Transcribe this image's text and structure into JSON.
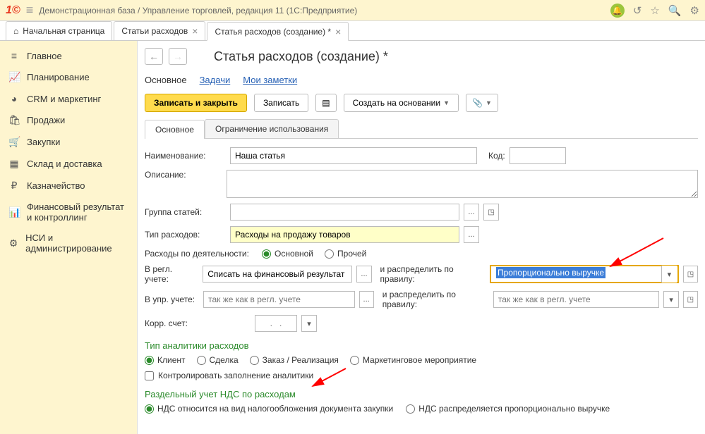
{
  "topbar": {
    "title": "Демонстрационная база / Управление торговлей, редакция 11  (1С:Предприятие)"
  },
  "tabs": {
    "home": "Начальная страница",
    "t1": "Статьи расходов",
    "t2": "Статья расходов (создание) *"
  },
  "sidebar": {
    "items": [
      {
        "icon": "≡",
        "label": "Главное"
      },
      {
        "icon": "📈",
        "label": "Планирование"
      },
      {
        "icon": "◕",
        "label": "CRM и маркетинг"
      },
      {
        "icon": "🛍",
        "label": "Продажи"
      },
      {
        "icon": "🛒",
        "label": "Закупки"
      },
      {
        "icon": "▦",
        "label": "Склад и доставка"
      },
      {
        "icon": "₽",
        "label": "Казначейство"
      },
      {
        "icon": "📊",
        "label": "Финансовый результат и контроллинг"
      },
      {
        "icon": "⚙",
        "label": "НСИ и администрирование"
      }
    ]
  },
  "page": {
    "title": "Статья расходов (создание) *",
    "subnav": {
      "main": "Основное",
      "tasks": "Задачи",
      "notes": "Мои заметки"
    },
    "toolbar": {
      "saveclose": "Записать и закрыть",
      "save": "Записать",
      "create": "Создать на основании"
    },
    "subtabs": {
      "main": "Основное",
      "restrict": "Ограничение использования"
    }
  },
  "form": {
    "name_lbl": "Наименование:",
    "name_val": "Наша статья",
    "code_lbl": "Код:",
    "desc_lbl": "Описание:",
    "group_lbl": "Группа статей:",
    "type_lbl": "Тип расходов:",
    "type_val": "Расходы на продажу товаров",
    "activity_lbl": "Расходы по деятельности:",
    "activity_main": "Основной",
    "activity_other": "Прочей",
    "reg_lbl": "В регл. учете:",
    "reg_val": "Списать на финансовый результат",
    "distr_lbl": "и распределить по правилу:",
    "distr_val": "Пропорционально выручке",
    "mgr_lbl": "В упр. учете:",
    "mgr_ph": "так же как в регл. учете",
    "distr2_ph": "так же как в регл. учете",
    "korr_lbl": "Корр. счет:",
    "korr_ph": ".   .",
    "analytics_head": "Тип аналитики расходов",
    "an_client": "Клиент",
    "an_deal": "Сделка",
    "an_order": "Заказ / Реализация",
    "an_marketing": "Маркетинговое мероприятие",
    "an_control": "Контролировать заполнение аналитики",
    "vat_head": "Раздельный учет НДС по расходам",
    "vat_opt1": "НДС относится на вид налогообложения документа закупки",
    "vat_opt2": "НДС распределяется пропорционально выручке"
  }
}
